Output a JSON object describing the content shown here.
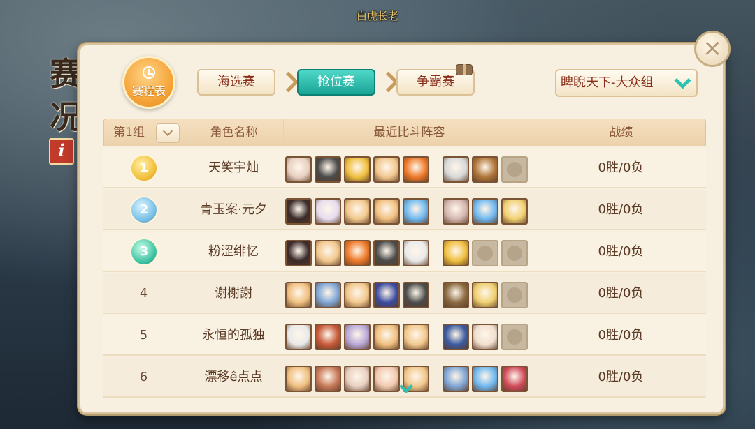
{
  "top_caption": "白虎长老",
  "side_title": [
    "赛",
    "况"
  ],
  "info_badge": "i",
  "schedule_label": "赛程表",
  "stages": [
    {
      "label": "海选赛",
      "active": false
    },
    {
      "label": "抢位赛",
      "active": true
    },
    {
      "label": "争霸赛",
      "active": false
    }
  ],
  "group_select": {
    "value": "睥睨天下-大众组"
  },
  "table": {
    "group_label": "第1组",
    "headers": {
      "name": "角色名称",
      "lineup": "最近比斗阵容",
      "record": "战绩"
    },
    "rows": [
      {
        "rank": "1",
        "medal": "gold",
        "name": "天笑宇灿",
        "record": "0胜/0负",
        "lineup": [
          "#e8d0c2",
          "#4b4b4b",
          "#f0c040",
          "#f2c88d",
          "#ef7a2a"
        ],
        "pets": [
          "#d9d9d9",
          "#b0763a",
          "empty"
        ]
      },
      {
        "rank": "2",
        "medal": "silver",
        "name": "青玉案·元夕",
        "record": "0胜/0负",
        "lineup": [
          "#3a2a2a",
          "#e6dcef",
          "#f2c88d",
          "#f0c080",
          "#6fb8f0"
        ],
        "pets": [
          "#d5b8b0",
          "#6fb8f0",
          "#f0d070"
        ]
      },
      {
        "rank": "3",
        "medal": "bronze",
        "name": "粉涩绯忆",
        "record": "0胜/0负",
        "lineup": [
          "#3a2a2a",
          "#f2c88d",
          "#ef7a2a",
          "#4b4b4b",
          "#eaeaea"
        ],
        "pets": [
          "#f0c040",
          "empty",
          "empty"
        ]
      },
      {
        "rank": "4",
        "medal": "",
        "name": "谢榭謝",
        "record": "0胜/0负",
        "lineup": [
          "#f0c080",
          "#7fa6d6",
          "#f2c88d",
          "#3a4aa0",
          "#4b4b4b"
        ],
        "pets": [
          "#8a6a40",
          "#f0d070",
          "empty"
        ]
      },
      {
        "rank": "5",
        "medal": "",
        "name": "永恒的孤独",
        "record": "0胜/0负",
        "lineup": [
          "#eaeaea",
          "#c85a3a",
          "#b8a8d8",
          "#f0c080",
          "#f2c88d"
        ],
        "pets": [
          "#3a5aa0",
          "#f2e0d0",
          "empty"
        ]
      },
      {
        "rank": "6",
        "medal": "",
        "name": "漂移ê点点",
        "record": "0胜/0负",
        "lineup": [
          "#f0c080",
          "#c87a5a",
          "#e8d0c2",
          "#f2c8b0",
          "#f2c88d"
        ],
        "pets": [
          "#7fa6d6",
          "#6fb8f0",
          "#d04a5a"
        ]
      }
    ]
  },
  "colors": {
    "accent": "#19a596",
    "panel": "#f7efdf",
    "header": "#ecd2ac",
    "text_dark_red": "#8a2e1a"
  },
  "icons": {
    "close": "close-icon",
    "schedule": "clock-icon",
    "gift": "gift-icon",
    "dropdown": "chevron-down-icon",
    "scroll": "chevron-down-icon"
  }
}
